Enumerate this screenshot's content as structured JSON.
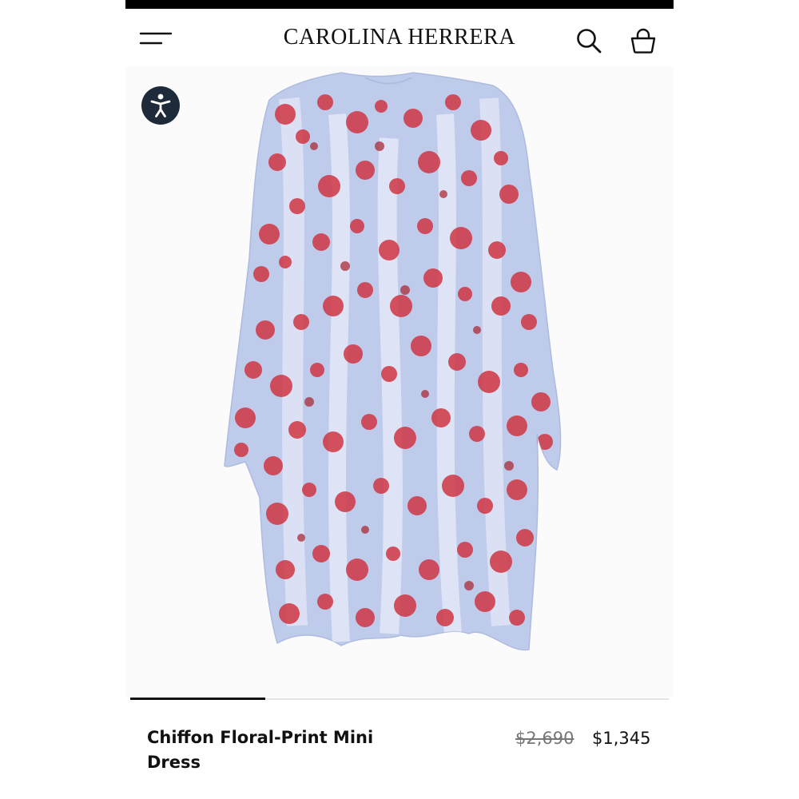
{
  "header": {
    "brand": "CAROLINA HERRERA",
    "menu_icon": "hamburger-menu-icon",
    "search_icon": "search-icon",
    "bag_icon": "shopping-bag-icon"
  },
  "accessibility": {
    "icon": "accessibility-person-icon"
  },
  "gallery": {
    "image_progress": 0.25
  },
  "product": {
    "name": "Chiffon Floral-Print Mini Dress",
    "original_price": "$2,690",
    "sale_price": "$1,345"
  },
  "colors": {
    "top_strip": "#000000",
    "accessibility_button": "#1e2a3a",
    "dress_base": "#b9c6e8",
    "floral_print": "#d0303d",
    "text": "#111111",
    "strikethrough_price": "#777777"
  }
}
